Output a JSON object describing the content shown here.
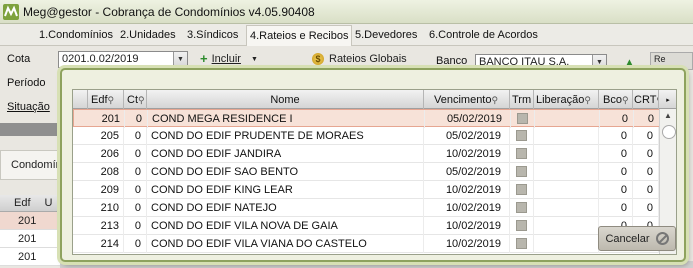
{
  "window": {
    "title": "Meg@gestor - Cobrança de Condomínios v4.05.90408"
  },
  "menu": [
    "1.Condomínios",
    "2.Unidades",
    "3.Síndicos",
    "4.Rateios e Recibos",
    "5.Devedores",
    "6.Controle de Acordos"
  ],
  "menu_active": "4.Rateios e Recibos",
  "form": {
    "cota_label": "Cota",
    "cota_value": "0201.0.02/2019",
    "periodo_label": "Período",
    "situacao_label": "Situação",
    "incluir_label": "Incluir",
    "rateios_label": "Rateios Globais",
    "banco_label": "Banco",
    "banco_value": "BANCO ITAU S.A.",
    "extra_button_label": "Re"
  },
  "background": {
    "condominio_tab": "Condomín",
    "grid_header": [
      "Edf",
      "U"
    ],
    "grid_rows": [
      "201",
      "201",
      "201"
    ]
  },
  "popup": {
    "columns": [
      "Edf",
      "Ct",
      "Nome",
      "Vencimento",
      "Trm",
      "Liberação",
      "Bco",
      "CRT"
    ],
    "rows": [
      {
        "edf": "201",
        "ct": "0",
        "nome": "COND MEGA RESIDENCE I",
        "vencimento": "05/02/2019",
        "bco": "0",
        "crt": "0"
      },
      {
        "edf": "205",
        "ct": "0",
        "nome": "COND DO EDIF PRUDENTE DE MORAES",
        "vencimento": "05/02/2019",
        "bco": "0",
        "crt": "0"
      },
      {
        "edf": "206",
        "ct": "0",
        "nome": "COND DO EDIF JANDIRA",
        "vencimento": "10/02/2019",
        "bco": "0",
        "crt": "0"
      },
      {
        "edf": "208",
        "ct": "0",
        "nome": "COND DO EDIF SAO BENTO",
        "vencimento": "05/02/2019",
        "bco": "0",
        "crt": "0"
      },
      {
        "edf": "209",
        "ct": "0",
        "nome": "COND DO EDIF KING LEAR",
        "vencimento": "10/02/2019",
        "bco": "0",
        "crt": "0"
      },
      {
        "edf": "210",
        "ct": "0",
        "nome": "COND DO EDIF NATEJO",
        "vencimento": "10/02/2019",
        "bco": "0",
        "crt": "0"
      },
      {
        "edf": "213",
        "ct": "0",
        "nome": "COND DO EDIF VILA NOVA DE GAIA",
        "vencimento": "10/02/2019",
        "bco": "0",
        "crt": "0"
      },
      {
        "edf": "214",
        "ct": "0",
        "nome": "COND DO EDIF VILA VIANA DO CASTELO",
        "vencimento": "10/02/2019",
        "bco": "0",
        "crt": "0"
      }
    ],
    "cancel_label": "Cancelar"
  }
}
